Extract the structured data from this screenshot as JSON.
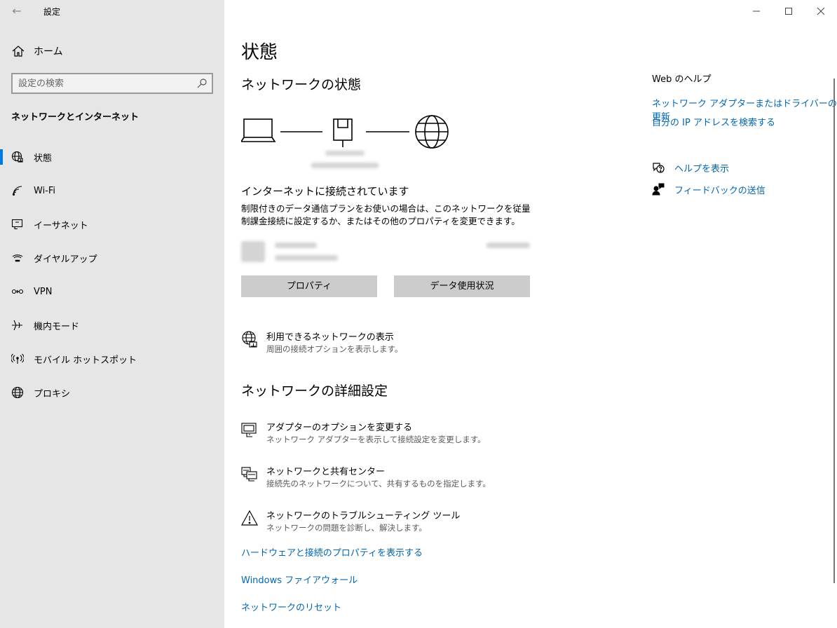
{
  "window": {
    "title": "設定",
    "back_glyph": "←",
    "controls": {
      "minimize": "—",
      "maximize": "☐",
      "close": "✕"
    }
  },
  "sidebar": {
    "home_label": "ホーム",
    "search_placeholder": "設定の検索",
    "section_heading": "ネットワークとインターネット",
    "items": [
      {
        "label": "状態",
        "icon": "globe-status-icon",
        "active": true
      },
      {
        "label": "Wi-Fi",
        "icon": "wifi-icon"
      },
      {
        "label": "イーサネット",
        "icon": "ethernet-icon"
      },
      {
        "label": "ダイヤルアップ",
        "icon": "dialup-icon"
      },
      {
        "label": "VPN",
        "icon": "vpn-icon"
      },
      {
        "label": "機内モード",
        "icon": "airplane-icon"
      },
      {
        "label": "モバイル ホットスポット",
        "icon": "hotspot-icon"
      },
      {
        "label": "プロキシ",
        "icon": "globe-icon"
      }
    ]
  },
  "main": {
    "page_title": "状態",
    "network_status_title": "ネットワークの状態",
    "connected_heading": "インターネットに接続されています",
    "connected_desc": "制限付きのデータ通信プランをお使いの場合は、このネットワークを従量制課金接続に設定するか、またはその他のプロパティを変更できます。",
    "buttons": {
      "properties": "プロパティ",
      "data_usage": "データ使用状況"
    },
    "show_networks": {
      "title": "利用できるネットワークの表示",
      "desc": "周囲の接続オプションを表示します。"
    },
    "advanced_title": "ネットワークの詳細設定",
    "advanced_items": [
      {
        "title": "アダプターのオプションを変更する",
        "desc": "ネットワーク アダプターを表示して接続設定を変更します。",
        "icon": "adapter-icon"
      },
      {
        "title": "ネットワークと共有センター",
        "desc": "接続先のネットワークについて、共有するものを指定します。",
        "icon": "sharing-center-icon"
      },
      {
        "title": "ネットワークのトラブルシューティング ツール",
        "desc": "ネットワークの問題を診断し、解決します。",
        "icon": "warning-icon"
      }
    ],
    "links": [
      "ハードウェアと接続のプロパティを表示する",
      "Windows ファイアウォール",
      "ネットワークのリセット"
    ]
  },
  "help": {
    "heading": "Web のヘルプ",
    "links": [
      "ネットワーク アダプターまたはドライバーの更新",
      "自分の IP アドレスを検索する"
    ],
    "get_help": "ヘルプを表示",
    "feedback": "フィードバックの送信"
  },
  "colors": {
    "accent": "#0078d7",
    "link": "#0066b4",
    "sidebar_bg": "#e6e6e6",
    "button_bg": "#cccccc"
  }
}
